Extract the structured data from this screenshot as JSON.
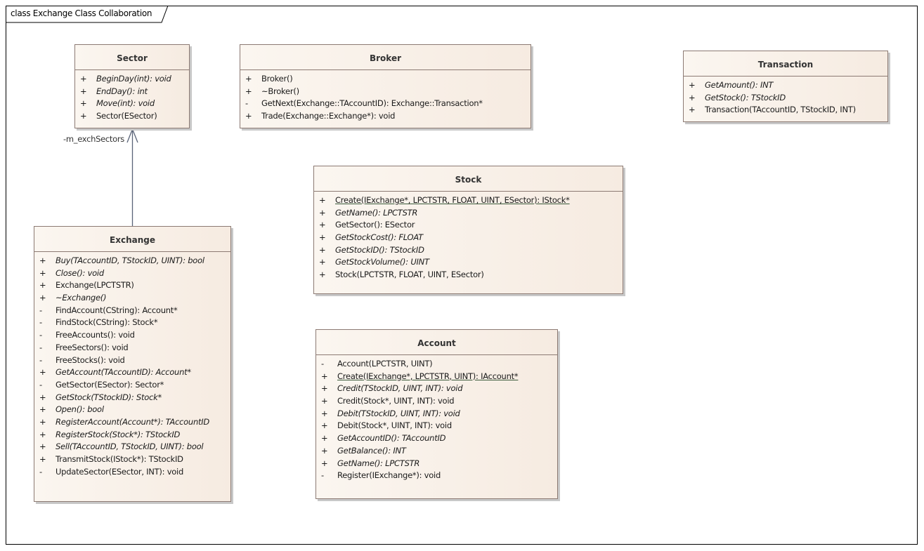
{
  "diagram": {
    "title": "class Exchange Class Collaboration"
  },
  "classes": {
    "sector": {
      "name": "Sector",
      "operations": [
        {
          "vis": "+",
          "sig": "BeginDay(int): void",
          "italic": true
        },
        {
          "vis": "+",
          "sig": "EndDay(): int",
          "italic": true
        },
        {
          "vis": "+",
          "sig": "Move(int): void",
          "italic": true
        },
        {
          "vis": "+",
          "sig": "Sector(ESector)",
          "italic": false
        }
      ]
    },
    "broker": {
      "name": "Broker",
      "operations": [
        {
          "vis": "+",
          "sig": "Broker()",
          "italic": false
        },
        {
          "vis": "+",
          "sig": "~Broker()",
          "italic": false
        },
        {
          "vis": "-",
          "sig": "GetNext(Exchange::TAccountID): Exchange::Transaction*",
          "italic": false
        },
        {
          "vis": "+",
          "sig": "Trade(Exchange::Exchange*): void",
          "italic": false
        }
      ]
    },
    "transaction": {
      "name": "Transaction",
      "operations": [
        {
          "vis": "+",
          "sig": "GetAmount(): INT",
          "italic": true
        },
        {
          "vis": "+",
          "sig": "GetStock(): TStockID",
          "italic": true
        },
        {
          "vis": "+",
          "sig": "Transaction(TAccountID, TStockID, INT)",
          "italic": false
        }
      ]
    },
    "stock": {
      "name": "Stock",
      "operations": [
        {
          "vis": "+",
          "sig": "Create(IExchange*, LPCTSTR, FLOAT, UINT, ESector): IStock*",
          "italic": false,
          "static": true
        },
        {
          "vis": "+",
          "sig": "GetName(): LPCTSTR",
          "italic": true
        },
        {
          "vis": "+",
          "sig": "GetSector(): ESector",
          "italic": false
        },
        {
          "vis": "+",
          "sig": "GetStockCost(): FLOAT",
          "italic": true
        },
        {
          "vis": "+",
          "sig": "GetStockID(): TStockID",
          "italic": true
        },
        {
          "vis": "+",
          "sig": "GetStockVolume(): UINT",
          "italic": true
        },
        {
          "vis": "+",
          "sig": "Stock(LPCTSTR, FLOAT, UINT, ESector)",
          "italic": false
        }
      ]
    },
    "exchange": {
      "name": "Exchange",
      "operations": [
        {
          "vis": "+",
          "sig": "Buy(TAccountID, TStockID, UINT): bool",
          "italic": true
        },
        {
          "vis": "+",
          "sig": "Close(): void",
          "italic": true
        },
        {
          "vis": "+",
          "sig": "Exchange(LPCTSTR)",
          "italic": false
        },
        {
          "vis": "+",
          "sig": "~Exchange()",
          "italic": true
        },
        {
          "vis": "-",
          "sig": "FindAccount(CString): Account*",
          "italic": false
        },
        {
          "vis": "-",
          "sig": "FindStock(CString): Stock*",
          "italic": false
        },
        {
          "vis": "-",
          "sig": "FreeAccounts(): void",
          "italic": false
        },
        {
          "vis": "-",
          "sig": "FreeSectors(): void",
          "italic": false
        },
        {
          "vis": "-",
          "sig": "FreeStocks(): void",
          "italic": false
        },
        {
          "vis": "+",
          "sig": "GetAccount(TAccountID): Account*",
          "italic": true
        },
        {
          "vis": "-",
          "sig": "GetSector(ESector): Sector*",
          "italic": false
        },
        {
          "vis": "+",
          "sig": "GetStock(TStockID): Stock*",
          "italic": true
        },
        {
          "vis": "+",
          "sig": "Open(): bool",
          "italic": true
        },
        {
          "vis": "+",
          "sig": "RegisterAccount(Account*): TAccountID",
          "italic": true
        },
        {
          "vis": "+",
          "sig": "RegisterStock(Stock*): TStockID",
          "italic": true
        },
        {
          "vis": "+",
          "sig": "Sell(TAccountID, TStockID, UINT): bool",
          "italic": true
        },
        {
          "vis": "+",
          "sig": "TransmitStock(IStock*): TStockID",
          "italic": false
        },
        {
          "vis": "-",
          "sig": "UpdateSector(ESector, INT): void",
          "italic": false
        }
      ]
    },
    "account": {
      "name": "Account",
      "operations": [
        {
          "vis": "-",
          "sig": "Account(LPCTSTR, UINT)",
          "italic": false
        },
        {
          "vis": "+",
          "sig": "Create(IExchange*, LPCTSTR, UINT): IAccount*",
          "italic": false,
          "static": true
        },
        {
          "vis": "+",
          "sig": "Credit(TStockID, UINT, INT): void",
          "italic": true
        },
        {
          "vis": "+",
          "sig": "Credit(Stock*, UINT, INT): void",
          "italic": false
        },
        {
          "vis": "+",
          "sig": "Debit(TStockID, UINT, INT): void",
          "italic": true
        },
        {
          "vis": "+",
          "sig": "Debit(Stock*, UINT, INT): void",
          "italic": false
        },
        {
          "vis": "+",
          "sig": "GetAccountID(): TAccountID",
          "italic": true
        },
        {
          "vis": "+",
          "sig": "GetBalance(): INT",
          "italic": true
        },
        {
          "vis": "+",
          "sig": "GetName(): LPCTSTR",
          "italic": true
        },
        {
          "vis": "-",
          "sig": "Register(IExchange*): void",
          "italic": false
        }
      ]
    }
  },
  "associations": [
    {
      "from": "Exchange",
      "to": "Sector",
      "role": "-m_exchSectors",
      "navigable": "to"
    }
  ],
  "colors": {
    "class_border": "#8c7a73",
    "class_fill_start": "#fbf6f0",
    "class_fill_end": "#f6ebe1",
    "association_line": "#5a6478"
  }
}
